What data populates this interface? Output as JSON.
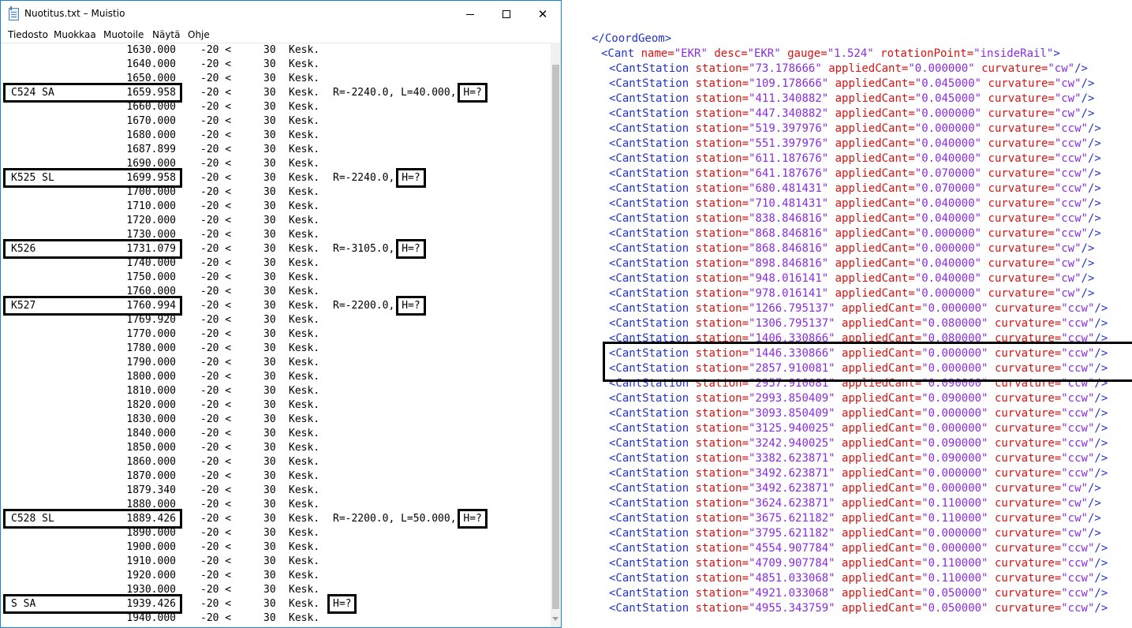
{
  "window": {
    "title": "Nuotitus.txt – Muistio",
    "icon": "notepad-icon",
    "controls": {
      "minimize": "minimize-icon",
      "maximize": "maximize-icon",
      "close": "close-icon"
    }
  },
  "menu": [
    "Tiedosto",
    "Muokkaa",
    "Muotoile",
    "Näytä",
    "Ohje"
  ],
  "notepad_lines": [
    {
      "label": "",
      "station": "1630.000",
      "min": "-20 <",
      "max": "30",
      "kesk": "Kesk.",
      "note": "",
      "hq": "",
      "hl": false
    },
    {
      "label": "",
      "station": "1640.000",
      "min": "-20 <",
      "max": "30",
      "kesk": "Kesk.",
      "note": "",
      "hq": "",
      "hl": false
    },
    {
      "label": "",
      "station": "1650.000",
      "min": "-20 <",
      "max": "30",
      "kesk": "Kesk.",
      "note": "",
      "hq": "",
      "hl": false
    },
    {
      "label": "C524 SA",
      "station": "1659.958",
      "min": "-20 <",
      "max": "30",
      "kesk": "Kesk.",
      "note": "R=-2240.0, L=40.000,",
      "hq": "H=?",
      "hl": true
    },
    {
      "label": "",
      "station": "1660.000",
      "min": "-20 <",
      "max": "30",
      "kesk": "Kesk.",
      "note": "",
      "hq": "",
      "hl": false
    },
    {
      "label": "",
      "station": "1670.000",
      "min": "-20 <",
      "max": "30",
      "kesk": "Kesk.",
      "note": "",
      "hq": "",
      "hl": false
    },
    {
      "label": "",
      "station": "1680.000",
      "min": "-20 <",
      "max": "30",
      "kesk": "Kesk.",
      "note": "",
      "hq": "",
      "hl": false
    },
    {
      "label": "",
      "station": "1687.899",
      "min": "-20 <",
      "max": "30",
      "kesk": "Kesk.",
      "note": "",
      "hq": "",
      "hl": false
    },
    {
      "label": "",
      "station": "1690.000",
      "min": "-20 <",
      "max": "30",
      "kesk": "Kesk.",
      "note": "",
      "hq": "",
      "hl": false
    },
    {
      "label": "K525 SL",
      "station": "1699.958",
      "min": "-20 <",
      "max": "30",
      "kesk": "Kesk.",
      "note": "R=-2240.0,",
      "hq": "H=?",
      "hl": true
    },
    {
      "label": "",
      "station": "1700.000",
      "min": "-20 <",
      "max": "30",
      "kesk": "Kesk.",
      "note": "",
      "hq": "",
      "hl": false
    },
    {
      "label": "",
      "station": "1710.000",
      "min": "-20 <",
      "max": "30",
      "kesk": "Kesk.",
      "note": "",
      "hq": "",
      "hl": false
    },
    {
      "label": "",
      "station": "1720.000",
      "min": "-20 <",
      "max": "30",
      "kesk": "Kesk.",
      "note": "",
      "hq": "",
      "hl": false
    },
    {
      "label": "",
      "station": "1730.000",
      "min": "-20 <",
      "max": "30",
      "kesk": "Kesk.",
      "note": "",
      "hq": "",
      "hl": false
    },
    {
      "label": "K526",
      "station": "1731.079",
      "min": "-20 <",
      "max": "30",
      "kesk": "Kesk.",
      "note": "R=-3105.0,",
      "hq": "H=?",
      "hl": true
    },
    {
      "label": "",
      "station": "1740.000",
      "min": "-20 <",
      "max": "30",
      "kesk": "Kesk.",
      "note": "",
      "hq": "",
      "hl": false
    },
    {
      "label": "",
      "station": "1750.000",
      "min": "-20 <",
      "max": "30",
      "kesk": "Kesk.",
      "note": "",
      "hq": "",
      "hl": false
    },
    {
      "label": "",
      "station": "1760.000",
      "min": "-20 <",
      "max": "30",
      "kesk": "Kesk.",
      "note": "",
      "hq": "",
      "hl": false
    },
    {
      "label": "K527",
      "station": "1760.994",
      "min": "-20 <",
      "max": "30",
      "kesk": "Kesk.",
      "note": "R=-2200.0,",
      "hq": "H=?",
      "hl": true
    },
    {
      "label": "",
      "station": "1769.920",
      "min": "-20 <",
      "max": "30",
      "kesk": "Kesk.",
      "note": "",
      "hq": "",
      "hl": false
    },
    {
      "label": "",
      "station": "1770.000",
      "min": "-20 <",
      "max": "30",
      "kesk": "Kesk.",
      "note": "",
      "hq": "",
      "hl": false
    },
    {
      "label": "",
      "station": "1780.000",
      "min": "-20 <",
      "max": "30",
      "kesk": "Kesk.",
      "note": "",
      "hq": "",
      "hl": false
    },
    {
      "label": "",
      "station": "1790.000",
      "min": "-20 <",
      "max": "30",
      "kesk": "Kesk.",
      "note": "",
      "hq": "",
      "hl": false
    },
    {
      "label": "",
      "station": "1800.000",
      "min": "-20 <",
      "max": "30",
      "kesk": "Kesk.",
      "note": "",
      "hq": "",
      "hl": false
    },
    {
      "label": "",
      "station": "1810.000",
      "min": "-20 <",
      "max": "30",
      "kesk": "Kesk.",
      "note": "",
      "hq": "",
      "hl": false
    },
    {
      "label": "",
      "station": "1820.000",
      "min": "-20 <",
      "max": "30",
      "kesk": "Kesk.",
      "note": "",
      "hq": "",
      "hl": false
    },
    {
      "label": "",
      "station": "1830.000",
      "min": "-20 <",
      "max": "30",
      "kesk": "Kesk.",
      "note": "",
      "hq": "",
      "hl": false
    },
    {
      "label": "",
      "station": "1840.000",
      "min": "-20 <",
      "max": "30",
      "kesk": "Kesk.",
      "note": "",
      "hq": "",
      "hl": false
    },
    {
      "label": "",
      "station": "1850.000",
      "min": "-20 <",
      "max": "30",
      "kesk": "Kesk.",
      "note": "",
      "hq": "",
      "hl": false
    },
    {
      "label": "",
      "station": "1860.000",
      "min": "-20 <",
      "max": "30",
      "kesk": "Kesk.",
      "note": "",
      "hq": "",
      "hl": false
    },
    {
      "label": "",
      "station": "1870.000",
      "min": "-20 <",
      "max": "30",
      "kesk": "Kesk.",
      "note": "",
      "hq": "",
      "hl": false
    },
    {
      "label": "",
      "station": "1879.340",
      "min": "-20 <",
      "max": "30",
      "kesk": "Kesk.",
      "note": "",
      "hq": "",
      "hl": false
    },
    {
      "label": "",
      "station": "1880.000",
      "min": "-20 <",
      "max": "30",
      "kesk": "Kesk.",
      "note": "",
      "hq": "",
      "hl": false
    },
    {
      "label": "C528 SL",
      "station": "1889.426",
      "min": "-20 <",
      "max": "30",
      "kesk": "Kesk.",
      "note": "R=-2200.0, L=50.000,",
      "hq": "H=?",
      "hl": true
    },
    {
      "label": "",
      "station": "1890.000",
      "min": "-20 <",
      "max": "30",
      "kesk": "Kesk.",
      "note": "",
      "hq": "",
      "hl": false
    },
    {
      "label": "",
      "station": "1900.000",
      "min": "-20 <",
      "max": "30",
      "kesk": "Kesk.",
      "note": "",
      "hq": "",
      "hl": false
    },
    {
      "label": "",
      "station": "1910.000",
      "min": "-20 <",
      "max": "30",
      "kesk": "Kesk.",
      "note": "",
      "hq": "",
      "hl": false
    },
    {
      "label": "",
      "station": "1920.000",
      "min": "-20 <",
      "max": "30",
      "kesk": "Kesk.",
      "note": "",
      "hq": "",
      "hl": false
    },
    {
      "label": "",
      "station": "1930.000",
      "min": "-20 <",
      "max": "30",
      "kesk": "Kesk.",
      "note": "",
      "hq": "",
      "hl": false
    },
    {
      "label": "S SA",
      "station": "1939.426",
      "min": "-20 <",
      "max": "30",
      "kesk": "Kesk.",
      "note": "",
      "hq": "H=?",
      "hl": true
    },
    {
      "label": "",
      "station": "1940.000",
      "min": "-20 <",
      "max": "30",
      "kesk": "Kesk.",
      "note": "",
      "hq": "",
      "hl": false
    }
  ],
  "xml": {
    "close_coordgeom": "</CoordGeom>",
    "cant_open": {
      "tag": "<Cant",
      "attrs": [
        {
          "name": "name",
          "value": "\"EKR\""
        },
        {
          "name": "desc",
          "value": "\"EKR\""
        },
        {
          "name": "gauge",
          "value": "\"1.524\""
        },
        {
          "name": "rotationPoint",
          "value": "\"insideRail\""
        }
      ],
      "end": ">"
    },
    "station_tag": "<CantStation",
    "station_attr": "station=",
    "applied_attr": "appliedCant=",
    "curvature_attr": "curvature=",
    "close_tag": "/>",
    "cant_stations": [
      {
        "station": "\"73.178666\"",
        "applied": "\"0.000000\"",
        "curvature": "\"cw\""
      },
      {
        "station": "\"109.178666\"",
        "applied": "\"0.045000\"",
        "curvature": "\"cw\""
      },
      {
        "station": "\"411.340882\"",
        "applied": "\"0.045000\"",
        "curvature": "\"cw\""
      },
      {
        "station": "\"447.340882\"",
        "applied": "\"0.000000\"",
        "curvature": "\"cw\""
      },
      {
        "station": "\"519.397976\"",
        "applied": "\"0.000000\"",
        "curvature": "\"ccw\""
      },
      {
        "station": "\"551.397976\"",
        "applied": "\"0.040000\"",
        "curvature": "\"ccw\""
      },
      {
        "station": "\"611.187676\"",
        "applied": "\"0.040000\"",
        "curvature": "\"ccw\""
      },
      {
        "station": "\"641.187676\"",
        "applied": "\"0.070000\"",
        "curvature": "\"ccw\""
      },
      {
        "station": "\"680.481431\"",
        "applied": "\"0.070000\"",
        "curvature": "\"ccw\""
      },
      {
        "station": "\"710.481431\"",
        "applied": "\"0.040000\"",
        "curvature": "\"ccw\""
      },
      {
        "station": "\"838.846816\"",
        "applied": "\"0.040000\"",
        "curvature": "\"ccw\""
      },
      {
        "station": "\"868.846816\"",
        "applied": "\"0.000000\"",
        "curvature": "\"ccw\""
      },
      {
        "station": "\"868.846816\"",
        "applied": "\"0.000000\"",
        "curvature": "\"cw\""
      },
      {
        "station": "\"898.846816\"",
        "applied": "\"0.040000\"",
        "curvature": "\"cw\""
      },
      {
        "station": "\"948.016141\"",
        "applied": "\"0.040000\"",
        "curvature": "\"cw\""
      },
      {
        "station": "\"978.016141\"",
        "applied": "\"0.000000\"",
        "curvature": "\"cw\""
      },
      {
        "station": "\"1266.795137\"",
        "applied": "\"0.000000\"",
        "curvature": "\"ccw\""
      },
      {
        "station": "\"1306.795137\"",
        "applied": "\"0.080000\"",
        "curvature": "\"ccw\""
      },
      {
        "station": "\"1406.330866\"",
        "applied": "\"0.080000\"",
        "curvature": "\"ccw\""
      },
      {
        "station": "\"1446.330866\"",
        "applied": "\"0.000000\"",
        "curvature": "\"ccw\""
      },
      {
        "station": "\"2857.910081\"",
        "applied": "\"0.000000\"",
        "curvature": "\"ccw\""
      },
      {
        "station": "\"2957.910081\"",
        "applied": "\"0.090000\"",
        "curvature": "\"ccw\""
      },
      {
        "station": "\"2993.850409\"",
        "applied": "\"0.090000\"",
        "curvature": "\"ccw\""
      },
      {
        "station": "\"3093.850409\"",
        "applied": "\"0.000000\"",
        "curvature": "\"ccw\""
      },
      {
        "station": "\"3125.940025\"",
        "applied": "\"0.000000\"",
        "curvature": "\"ccw\""
      },
      {
        "station": "\"3242.940025\"",
        "applied": "\"0.090000\"",
        "curvature": "\"ccw\""
      },
      {
        "station": "\"3382.623871\"",
        "applied": "\"0.090000\"",
        "curvature": "\"ccw\""
      },
      {
        "station": "\"3492.623871\"",
        "applied": "\"0.000000\"",
        "curvature": "\"ccw\""
      },
      {
        "station": "\"3492.623871\"",
        "applied": "\"0.000000\"",
        "curvature": "\"cw\""
      },
      {
        "station": "\"3624.623871\"",
        "applied": "\"0.110000\"",
        "curvature": "\"cw\""
      },
      {
        "station": "\"3675.621182\"",
        "applied": "\"0.110000\"",
        "curvature": "\"cw\""
      },
      {
        "station": "\"3795.621182\"",
        "applied": "\"0.000000\"",
        "curvature": "\"cw\""
      },
      {
        "station": "\"4554.907784\"",
        "applied": "\"0.000000\"",
        "curvature": "\"ccw\""
      },
      {
        "station": "\"4709.907784\"",
        "applied": "\"0.110000\"",
        "curvature": "\"ccw\""
      },
      {
        "station": "\"4851.033068\"",
        "applied": "\"0.110000\"",
        "curvature": "\"ccw\""
      },
      {
        "station": "\"4921.033068\"",
        "applied": "\"0.050000\"",
        "curvature": "\"ccw\""
      },
      {
        "station": "\"4955.343759\"",
        "applied": "\"0.050000\"",
        "curvature": "\"ccw\""
      }
    ]
  }
}
